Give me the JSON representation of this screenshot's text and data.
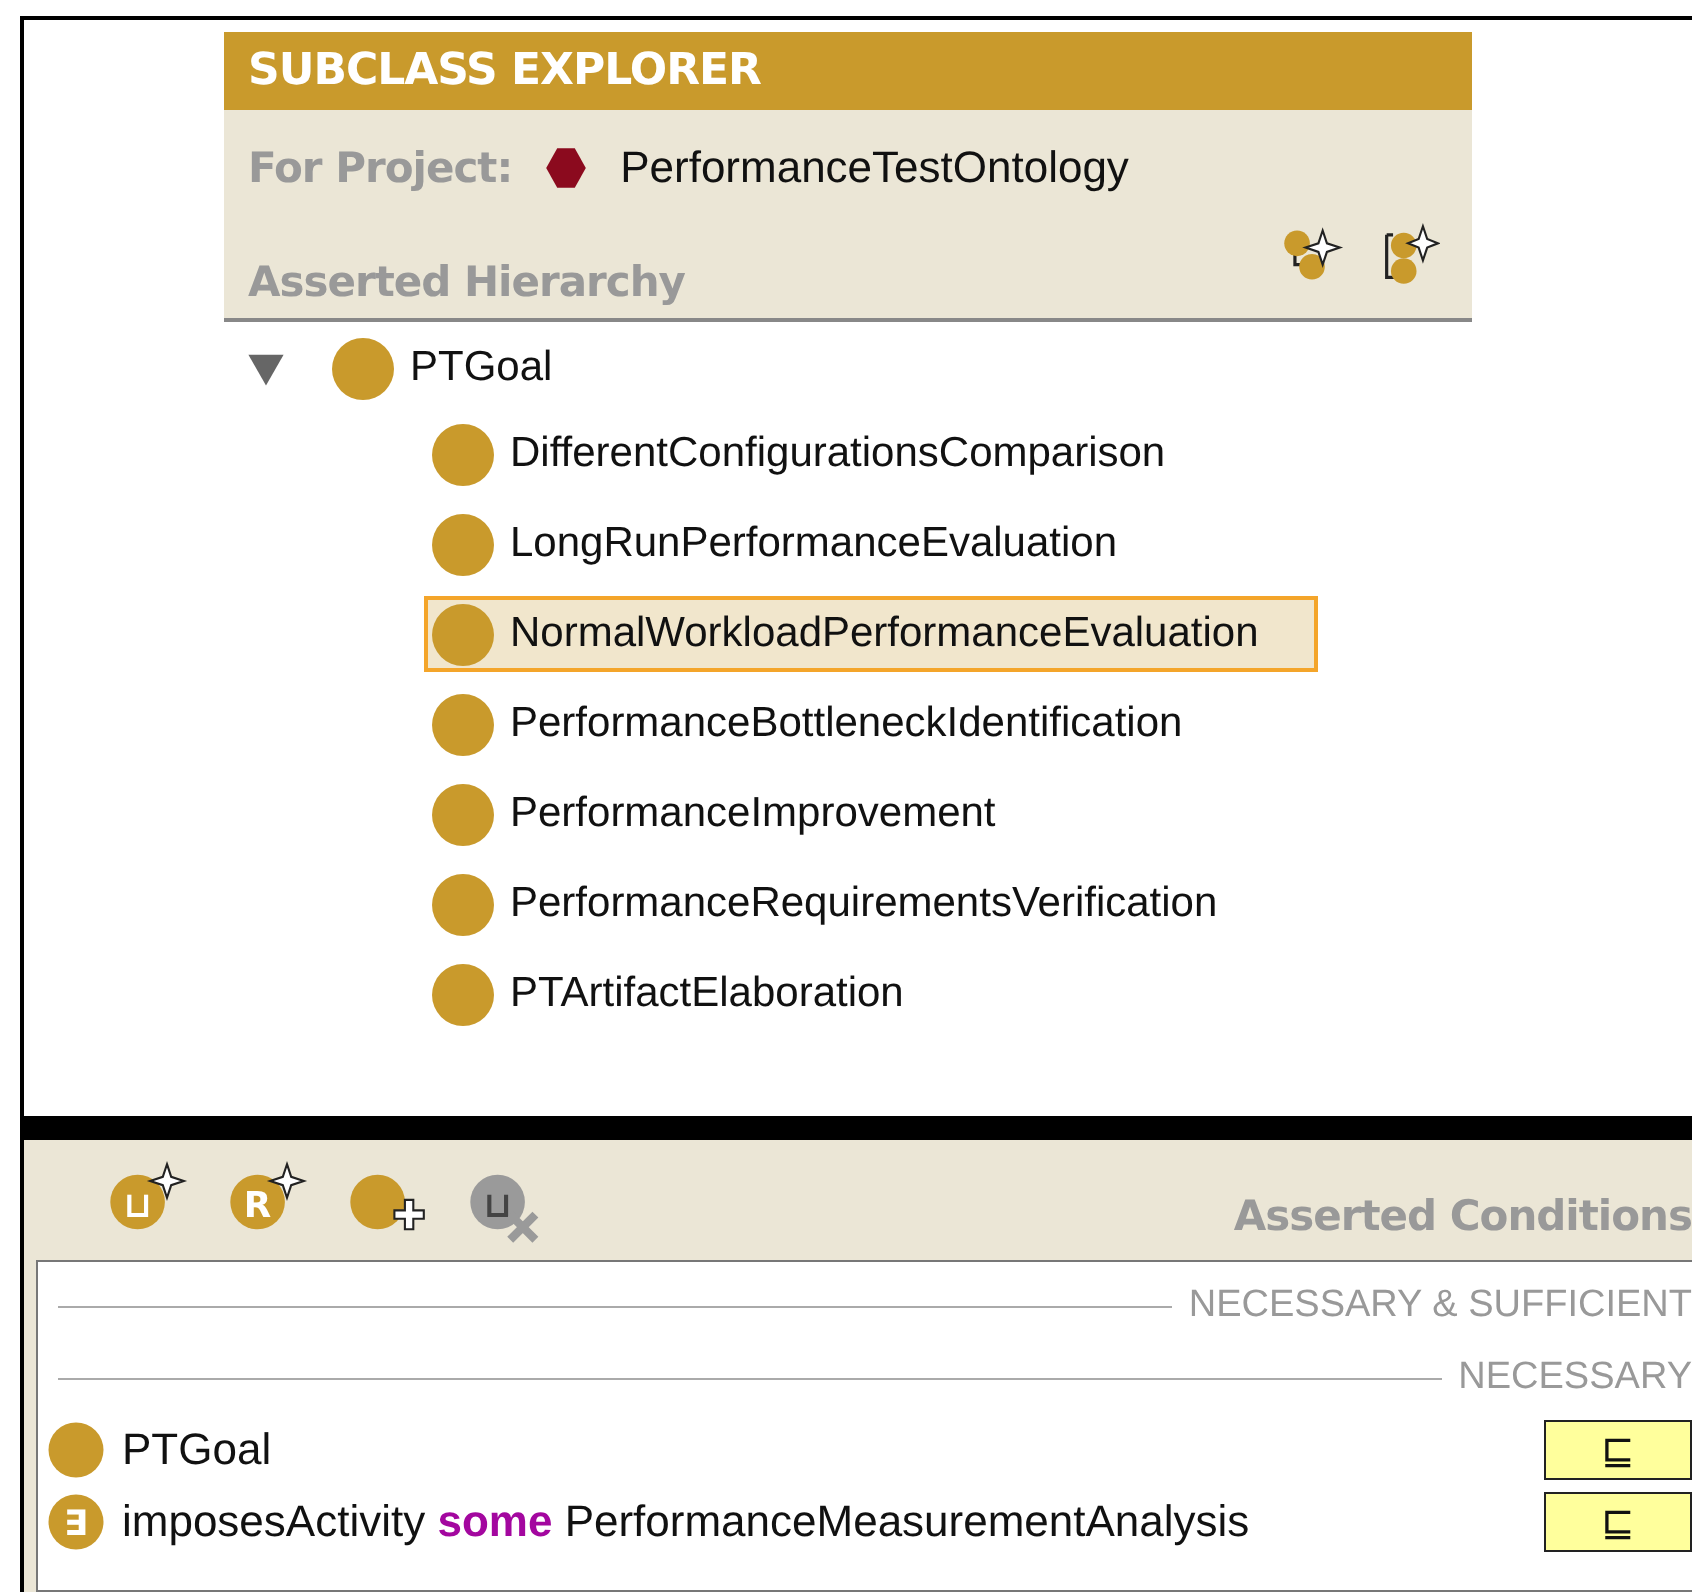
{
  "explorer": {
    "title": "SUBCLASS EXPLORER",
    "project_label": "For Project:",
    "project_name": "PerformanceTestOntology",
    "section": "Asserted Hierarchy"
  },
  "tree": [
    {
      "label": "PTGoal",
      "expanded": true,
      "selected": false,
      "children": [
        {
          "label": "DifferentConfigurationsComparison",
          "selected": false
        },
        {
          "label": "LongRunPerformanceEvaluation",
          "selected": false
        },
        {
          "label": "NormalWorkloadPerformanceEvaluation",
          "selected": true
        },
        {
          "label": "PerformanceBottleneckIdentification",
          "selected": false
        },
        {
          "label": "PerformanceImprovement",
          "selected": false
        },
        {
          "label": "PerformanceRequirementsVerification",
          "selected": false
        },
        {
          "label": "PTArtifactElaboration",
          "selected": false
        }
      ]
    }
  ],
  "conditions_toolbar": [
    {
      "kind": "create",
      "glyph": "⊔",
      "disabled": false
    },
    {
      "kind": "create",
      "glyph": "R",
      "disabled": false
    },
    {
      "kind": "add",
      "disabled": false
    },
    {
      "kind": "remove",
      "glyph": "⊔",
      "disabled": true
    }
  ],
  "conditions_title": "Asserted Conditions",
  "condition_groups": [
    {
      "label": "NECESSARY & SUFFICIENT"
    },
    {
      "label": "NECESSARY",
      "rows": [
        {
          "kind": "class",
          "name": "PTGoal",
          "relation": "⊑"
        },
        {
          "kind": "restriction",
          "glyph": "∃",
          "property": "imposesActivity",
          "quantifier": "some",
          "filler": "PerformanceMeasurementAnalysis",
          "relation": "⊑"
        }
      ]
    }
  ]
}
